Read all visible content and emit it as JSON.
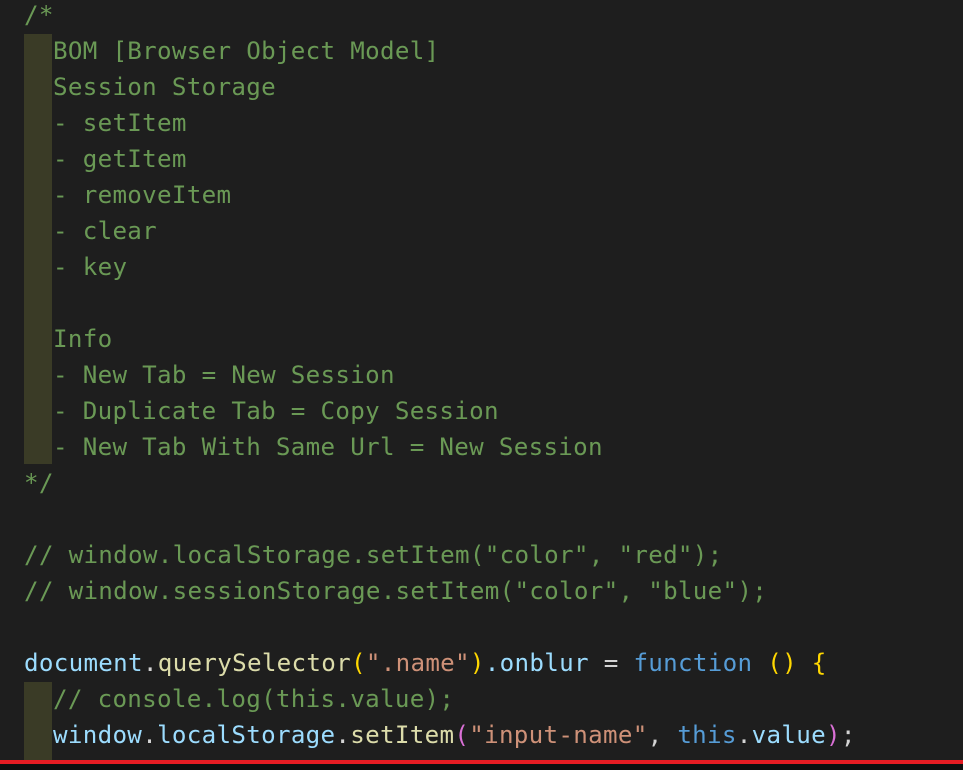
{
  "code": {
    "l1": "/*",
    "l2": "BOM [Browser Object Model]",
    "l3": "Session Storage",
    "l4": "- setItem",
    "l5": "- getItem",
    "l6": "- removeItem",
    "l7": "- clear",
    "l8": "- key",
    "l10": "Info",
    "l11": "- New Tab = New Session",
    "l12": "- Duplicate Tab = Copy Session",
    "l13": "- New Tab With Same Url = New Session",
    "l14": "*/",
    "l16": "// window.localStorage.setItem(\"color\", \"red\");",
    "l17": "// window.sessionStorage.setItem(\"color\", \"blue\");",
    "l19": {
      "obj": "document",
      "dot1": ".",
      "method": "querySelector",
      "open": "(",
      "arg": "\".name\"",
      "close": ")",
      "prop": ".onblur",
      "eq": " = ",
      "kw": "function",
      "params": " ()",
      "brace": " {"
    },
    "l20": "// console.log(this.value);",
    "l21": {
      "obj": "window",
      "dot1": ".",
      "prop": "localStorage",
      "dot2": ".",
      "method": "setItem",
      "open": "(",
      "arg1": "\"input-name\"",
      "comma": ", ",
      "kw": "this",
      "dot3": ".",
      "value": "value",
      "close": ")",
      "semi": ";"
    }
  }
}
